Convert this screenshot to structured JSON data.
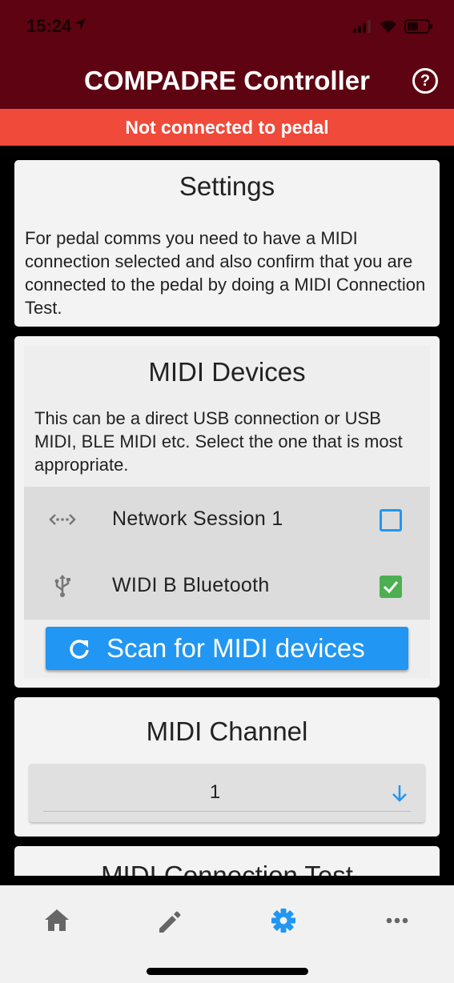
{
  "status_bar": {
    "time": "15:24"
  },
  "app_bar": {
    "title": "COMPADRE Controller",
    "help_label": "?"
  },
  "banner": {
    "text": "Not connected to pedal",
    "color": "#ef4a3a"
  },
  "settings_card": {
    "title": "Settings",
    "description": "For pedal comms you need to have a MIDI connection selected and also confirm that you are connected to the pedal by doing a MIDI Connection Test."
  },
  "devices_card": {
    "title": "MIDI Devices",
    "description": "This can be a direct USB connection or USB MIDI, BLE MIDI etc. Select the one that is most appropriate.",
    "devices": [
      {
        "name": "Network Session 1",
        "icon": "network-icon",
        "selected": false
      },
      {
        "name": "WIDI B Bluetooth",
        "icon": "usb-icon",
        "selected": true
      }
    ],
    "scan_button_label": "Scan for MIDI devices"
  },
  "channel_card": {
    "title": "MIDI Channel",
    "value": "1"
  },
  "test_card": {
    "title": "MIDI Connection Test"
  },
  "bottom_nav": {
    "items": [
      {
        "icon": "home-icon",
        "active": false
      },
      {
        "icon": "edit-icon",
        "active": false
      },
      {
        "icon": "gear-icon",
        "active": true
      },
      {
        "icon": "more-icon",
        "active": false
      }
    ]
  },
  "colors": {
    "app_bar": "#5e0311",
    "accent": "#2196f3",
    "checked": "#4caf50",
    "inactive_icon": "#666666"
  }
}
